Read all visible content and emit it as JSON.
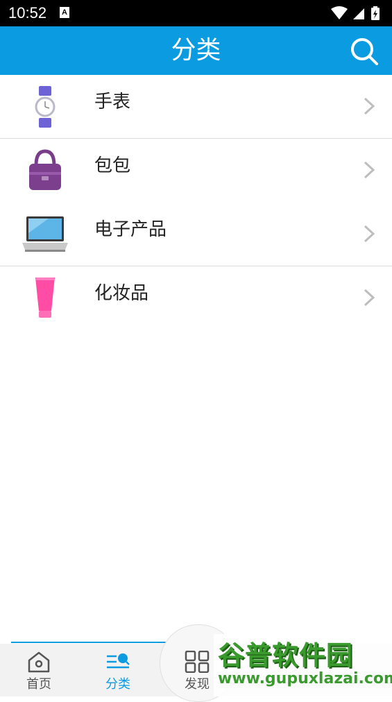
{
  "status_bar": {
    "time": "10:52",
    "notif_badge": "A"
  },
  "header": {
    "title": "分类"
  },
  "categories": [
    {
      "label": "手表",
      "icon": "watch-icon"
    },
    {
      "label": "包包",
      "icon": "handbag-icon"
    },
    {
      "label": "电子产品",
      "icon": "laptop-icon"
    },
    {
      "label": "化妆品",
      "icon": "cosmetic-tube-icon"
    }
  ],
  "bottom_nav": {
    "items": [
      {
        "label": "首页",
        "icon": "home-icon",
        "active": false
      },
      {
        "label": "分类",
        "icon": "category-icon",
        "active": true
      },
      {
        "label": "发现",
        "icon": "grid-icon",
        "active": false
      }
    ]
  },
  "watermark": {
    "title": "谷普软件园",
    "url": "www.gupuxlazai.com"
  },
  "colors": {
    "accent": "#0b9be0",
    "text": "#222222",
    "divider": "#d9d9d9",
    "inactive": "#555555"
  }
}
